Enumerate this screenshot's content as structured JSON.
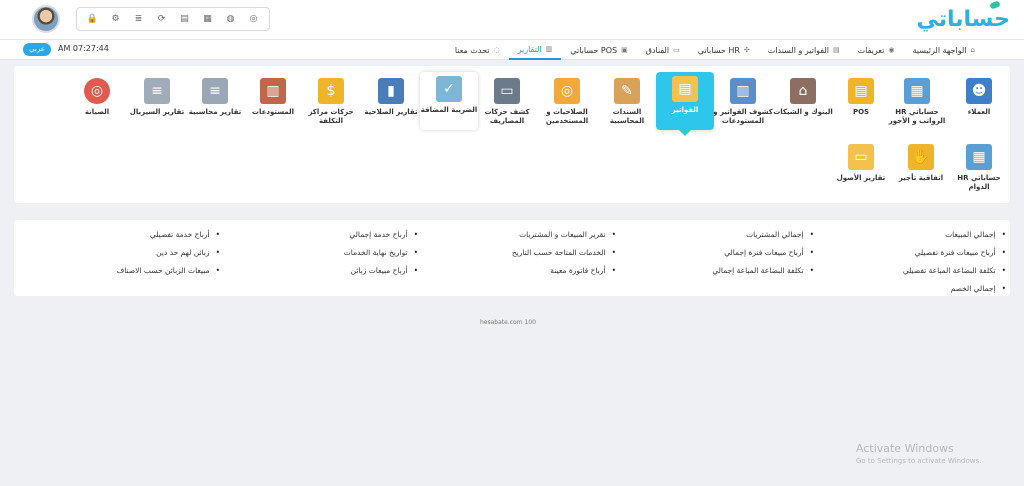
{
  "brand": {
    "logo_text": "حساباتي"
  },
  "toolbar": {
    "icons": [
      "lock-icon",
      "settings-icon",
      "database-icon",
      "sync-icon",
      "printer-icon",
      "grid-icon",
      "money-bag-icon",
      "currency-icon"
    ]
  },
  "nav": {
    "items": [
      {
        "label": "الواجهة الرئيسية",
        "icon": "home-icon"
      },
      {
        "label": "تعريفات",
        "icon": "eye-icon"
      },
      {
        "label": "الفواتير و السندات",
        "icon": "invoice-icon"
      },
      {
        "label": "حساباتي HR",
        "icon": "people-icon"
      },
      {
        "label": "الفنادق",
        "icon": "bed-icon"
      },
      {
        "label": "حساباتي POS",
        "icon": "pos-icon"
      },
      {
        "label": "التقارير",
        "icon": "report-icon",
        "active": true
      },
      {
        "label": "تحدث معنا",
        "icon": "chat-icon"
      }
    ],
    "clock": "AM 07:27:44",
    "language_button": "عربي"
  },
  "report_tiles": [
    {
      "label": "العملاء",
      "icon": "customers-icon",
      "color": "#3e7fc7"
    },
    {
      "label": "حساباتي HR الرواتب و الأجور",
      "icon": "hr-salary-icon",
      "color": "#5a9fd4"
    },
    {
      "label": "POS",
      "icon": "pos-receipt-icon",
      "color": "#f0b429"
    },
    {
      "label": "البنوك و الشيكات",
      "icon": "bank-icon",
      "color": "#8d6e63"
    },
    {
      "label": "كشوف الفواتير و المستودعات",
      "icon": "statements-icon",
      "color": "#5c8fc9"
    },
    {
      "label": "الفواتير",
      "icon": "invoice-doc-icon",
      "color": "#f2c14e",
      "active": true
    },
    {
      "label": "السندات المحاسبية",
      "icon": "voucher-icon",
      "color": "#d9a25a"
    },
    {
      "label": "الصلاحيات و المستخدمين",
      "icon": "users-coins-icon",
      "color": "#f2a93b"
    },
    {
      "label": "كشف حركات المصاريف",
      "icon": "expenses-icon",
      "color": "#6b7b8c"
    },
    {
      "label": "الضريبة المضافة",
      "icon": "tax-cheque-icon",
      "color": "#7fb5d5",
      "highlight": true
    },
    {
      "label": "تقارير الصلاحية",
      "icon": "validity-book-icon",
      "color": "#4a7db8"
    },
    {
      "label": "حركات مراكز التكلفة",
      "icon": "cost-center-icon",
      "color": "#f0b429"
    },
    {
      "label": "المستودعات",
      "icon": "warehouse-icon",
      "color": "#c0674b"
    },
    {
      "label": "تقارير محاسبية",
      "icon": "accounting-doc-icon",
      "color": "#9aa8b5"
    },
    {
      "label": "تقارير السيريال",
      "icon": "serial-doc-icon",
      "color": "#a0acb8"
    },
    {
      "label": "الصيانة",
      "icon": "lifebuoy-icon",
      "color": "#e05a4f"
    },
    {
      "label": "حساباتي HR الدوام",
      "icon": "hr-attendance-icon",
      "color": "#5a9fd4"
    },
    {
      "label": "اتفاقية تأجير",
      "icon": "handshake-icon",
      "color": "#f0b429"
    },
    {
      "label": "تقارير الأصول",
      "icon": "assets-folder-icon",
      "color": "#f2c14e"
    }
  ],
  "invoice_links": {
    "col1": [
      "إجمالي المبيعات",
      "أرباح مبيعات فترة تفصيلي",
      "تكلفة البضاعة المباعة تفصيلي",
      "إجمالي الخصم"
    ],
    "col2": [
      "إجمالي المشتريات",
      "أرباح مبيعات فترة إجمالي",
      "تكلفة البضاعة المباعة إجمالي"
    ],
    "col3": [
      "تقرير المبيعات و المشتريات",
      "الخدمات المتاحة حسب التاريخ",
      "أرباح فاتورة معينة"
    ],
    "col4": [
      "أرباح خدمة إجمالي",
      "تواريخ نهاية الخدمات",
      "أرباح مبيعات زبائن"
    ],
    "col5": [
      "أرباح خدمة تفصيلي",
      "زبائن لهم حد دين",
      "مبيعات الزبائن حسب الاصناف"
    ]
  },
  "footer": {
    "text": "hesabate.com 100"
  },
  "watermark": {
    "title": "Activate Windows",
    "subtitle": "Go to Settings to activate Windows."
  }
}
